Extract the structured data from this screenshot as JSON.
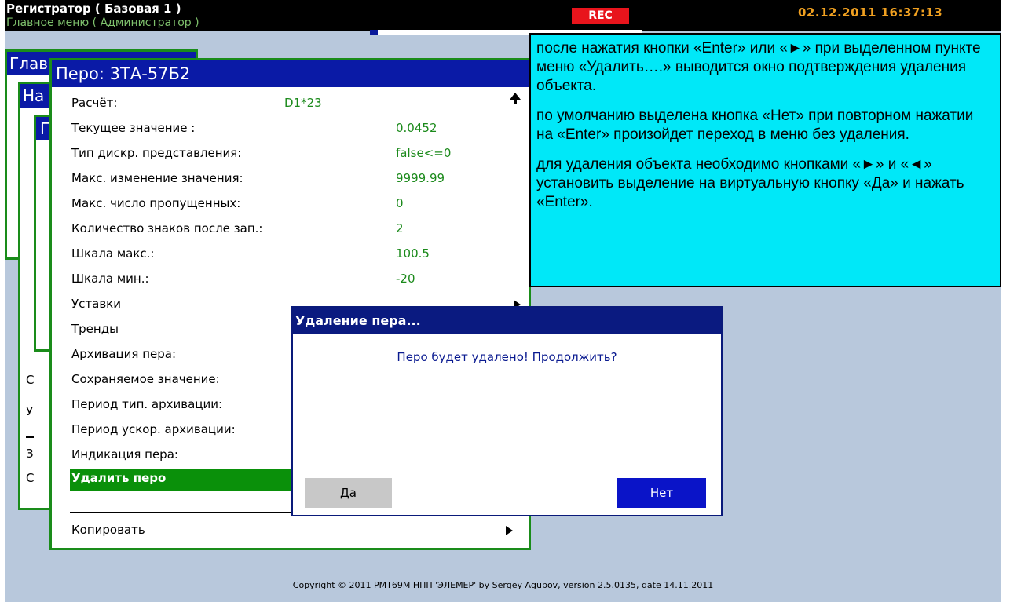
{
  "header": {
    "title": "Регистратор ( Базовая 1 )",
    "subtitle": "Главное меню ( Администратор )",
    "rec_label": "REC",
    "datetime": "02.12.2011   16:37:13",
    "progress": 0.03
  },
  "background_windows": {
    "main_title_fragment": "Глав",
    "settings_title_fragment": "На",
    "third_title_fragment": "П",
    "side_letters": [
      "С",
      "У",
      "З",
      "С"
    ]
  },
  "pen_window": {
    "title": "Перо: 3ТА-57Б2",
    "rows": [
      {
        "label": "Расчёт:",
        "value": "D1*23"
      },
      {
        "label": "Текущее значение :",
        "value": "0.0452"
      },
      {
        "label": "Тип дискр. представления:",
        "value": "false<=0"
      },
      {
        "label": "Макс. изменение значения:",
        "value": "9999.99"
      },
      {
        "label": "Макс. число пропущенных:",
        "value": "0"
      },
      {
        "label": "Количество знаков после зап.:",
        "value": "2"
      },
      {
        "label": "Шкала макс.:",
        "value": "100.5"
      },
      {
        "label": "Шкала мин.:",
        "value": "-20"
      },
      {
        "label": "Уставки",
        "value": ""
      },
      {
        "label": "Тренды",
        "value": ""
      },
      {
        "label": "Архивация пера:",
        "value": ""
      },
      {
        "label": "Сохраняемое значение:",
        "value": ""
      },
      {
        "label": "Период тип. архивации:",
        "value": ""
      },
      {
        "label": "Период ускор. архивации:",
        "value": ""
      },
      {
        "label": "Индикация пера:",
        "value": ""
      },
      {
        "label": "Удалить перо",
        "value": ""
      },
      {
        "label": "Копировать",
        "value": ""
      }
    ]
  },
  "dialog": {
    "title": "Удаление пера...",
    "message": "Перо будет удалено! Продолжить?",
    "yes_label": "Да",
    "no_label": "Нет"
  },
  "note": {
    "p1": "после нажатия кнопки «Enter» или «►» при выделенном пункте меню «Удалить….» выводится окно подтверждения удаления объекта.",
    "p2": "по умолчанию выделена кнопка «Нет» при повторном нажатии на «Enter» произойдет переход в меню без удаления.",
    "p3": "для удаления объекта необходимо кнопками «►» и «◄» установить выделение на виртуальную кнопку «Да» и нажать «Enter»."
  },
  "footer": {
    "copyright": "Copyright © 2011 РМТ69М НПП 'ЭЛЕМЕР' by Sergey Agupov, version 2.5.0135, date 14.11.2011"
  }
}
